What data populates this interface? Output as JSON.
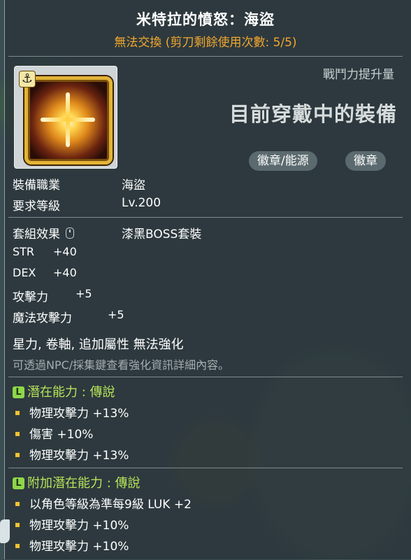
{
  "item": {
    "name": "米特拉的憤怒：海盜",
    "trade_status": "無法交換 (剪刀剩餘使用次數: 5/5)",
    "power_label": "戰鬥力提升量",
    "equipped_text": "目前穿戴中的裝備",
    "tags": [
      "徽章/能源",
      "徽章"
    ],
    "icon": "emblem-icon",
    "anchor_icon": "⚓"
  },
  "requirements": [
    {
      "label": "裝備職業",
      "value": "海盜"
    },
    {
      "label": "要求等級",
      "value": "Lv.200"
    }
  ],
  "set_effect": {
    "label": "套組效果",
    "value": "漆黑BOSS套裝"
  },
  "stats": [
    {
      "name": "STR",
      "value": "+40"
    },
    {
      "name": "DEX",
      "value": "+40"
    },
    {
      "name": "攻擊力",
      "value": "+5"
    },
    {
      "name": "魔法攻擊力",
      "value": "+5"
    }
  ],
  "restrictions": "星力, 卷軸, 追加屬性 無法強化",
  "info_note": "可透過NPC/採集鍵查看強化資訊詳細內容。",
  "potential": {
    "header": "潛在能力 : 傳說",
    "badge": "L",
    "lines": [
      "物理攻擊力 +13%",
      "傷害 +10%",
      "物理攻擊力 +13%"
    ]
  },
  "bonus_potential": {
    "header": "附加潛在能力 : 傳說",
    "badge": "L",
    "lines": [
      "以角色等級為準每9級 LUK +2",
      "物理攻擊力 +10%",
      "物理攻擊力 +10%"
    ]
  },
  "colors": {
    "title": "#ffffff",
    "trade_status": "#f2a72e",
    "potential_header": "#b6e35a",
    "bullet": "#f2c230",
    "note": "#a5aeb1"
  }
}
